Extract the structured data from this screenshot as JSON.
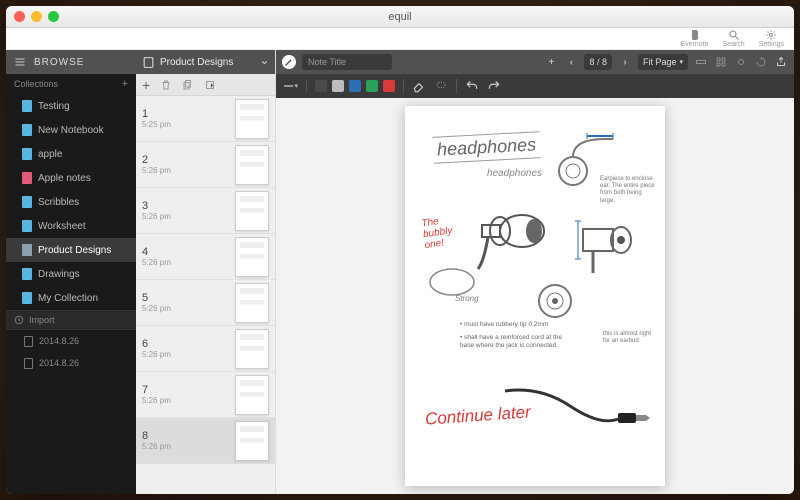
{
  "window": {
    "title": "equil"
  },
  "header": {
    "items": [
      {
        "icon": "evernote-icon",
        "label": "Evernote"
      },
      {
        "icon": "search-icon",
        "label": "Search"
      },
      {
        "icon": "gear-icon",
        "label": "Settings"
      }
    ]
  },
  "sidebar": {
    "browse_label": "BROWSE",
    "collections_label": "Collections",
    "items": [
      {
        "label": "Testing",
        "color": "#5ab4e0"
      },
      {
        "label": "New Notebook",
        "color": "#5ab4e0"
      },
      {
        "label": "apple",
        "color": "#5ab4e0"
      },
      {
        "label": "Apple notes",
        "color": "#e05a7a"
      },
      {
        "label": "Scribbles",
        "color": "#5ab4e0"
      },
      {
        "label": "Worksheet",
        "color": "#5ab4e0"
      },
      {
        "label": "Product Designs",
        "color": "#8aa0b0",
        "selected": true
      },
      {
        "label": "Drawings",
        "color": "#5ab4e0"
      },
      {
        "label": "My Collection",
        "color": "#5ab4e0"
      }
    ],
    "import_label": "Import",
    "imports": [
      {
        "label": "2014.8.26"
      },
      {
        "label": "2014.8.26"
      }
    ]
  },
  "pages_panel": {
    "title": "Product Designs",
    "pages": [
      {
        "num": "1",
        "time": "5:25 pm"
      },
      {
        "num": "2",
        "time": "5:26 pm"
      },
      {
        "num": "3",
        "time": "5:26 pm"
      },
      {
        "num": "4",
        "time": "5:26 pm"
      },
      {
        "num": "5",
        "time": "5:26 pm"
      },
      {
        "num": "6",
        "time": "5:26 pm"
      },
      {
        "num": "7",
        "time": "5:26 pm"
      },
      {
        "num": "8",
        "time": "5:26 pm",
        "selected": true
      }
    ]
  },
  "toolbar": {
    "note_title_placeholder": "Note Title",
    "page_indicator": "8 / 8",
    "zoom_label": "Fit Page",
    "colors": [
      "#4a4a4a",
      "#bdbdbd",
      "#2d6fb5",
      "#2aa05a",
      "#d93a3a"
    ]
  },
  "sketch": {
    "title": "headphones",
    "subtitle": "headphones",
    "note_red1": "The bubbly one!",
    "label_strong": "Strong",
    "bullet1": "• must have rubbery tip 0.2mm",
    "bullet2": "• shall have a reinforced cord at the base where the jack is connected.",
    "annot_right1": "Earpiece to enclose ear. The entire piece from both being large.",
    "annot_right2": "this is almost right for an earbud",
    "note_red2": "Continue later"
  }
}
